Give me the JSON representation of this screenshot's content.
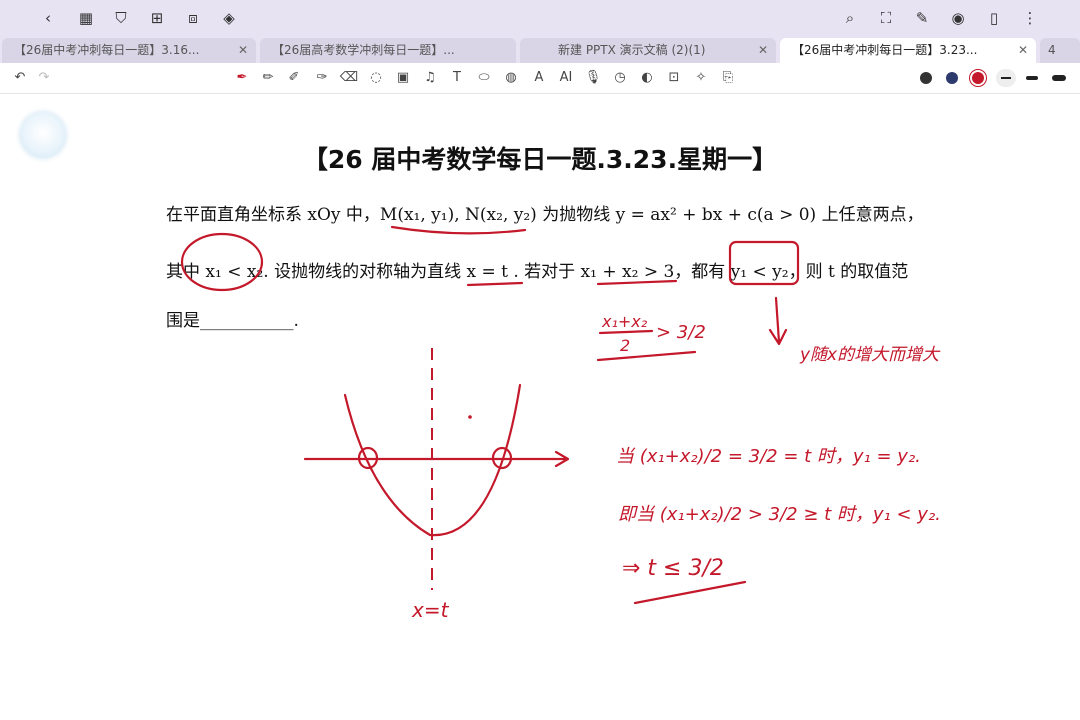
{
  "titlebar": {
    "left_icons": [
      "back-icon",
      "grid-icon",
      "bookmark-icon",
      "add-page-icon",
      "crop-icon",
      "layers-icon"
    ],
    "right_icons": [
      "search-icon",
      "shirt-icon",
      "pen-edit-icon",
      "eye-icon",
      "phone-icon",
      "more-icon"
    ]
  },
  "tabs": [
    {
      "label": "【26届中考冲刺每日一题】3.16...",
      "active": false
    },
    {
      "label": "【26届高考数学冲刺每日一题】...",
      "active": false
    },
    {
      "label": "新建 PPTX 演示文稿 (2)(1)",
      "active": false
    },
    {
      "label": "【26届中考冲刺每日一题】3.23...",
      "active": true
    },
    {
      "label": "4",
      "active": false
    }
  ],
  "toolbar": {
    "colors": [
      "#333333",
      "#2d3a6e",
      "#c4182b",
      "#555555"
    ]
  },
  "document": {
    "title": "【26 届中考数学每日一题.3.23.星期一】",
    "line1": "在平面直角坐标系 xOy 中，M(x₁, y₁), N(x₂, y₂) 为抛物线 y = ax² + bx + c(a > 0) 上任意两点，",
    "line2": "其中 x₁ < x₂. 设抛物线的对称轴为直线 x = t . 若对于 x₁ + x₂ > 3，都有 y₁ < y₂，则 t 的取值范",
    "line3": "围是___________."
  },
  "annotations": {
    "frac1": "x₁+x₂",
    "frac1_den": "2",
    "gt32": "> 3/2",
    "arrow_note": "y随x的增大而增大",
    "case1": "当 (x₁+x₂)/2 = 3/2 = t 时，y₁ = y₂.",
    "case2": "即当 (x₁+x₂)/2 > 3/2 ≥ t 时，y₁ < y₂.",
    "answer": "⇒ t ≤ 3/2",
    "axis_label": "x=t"
  }
}
